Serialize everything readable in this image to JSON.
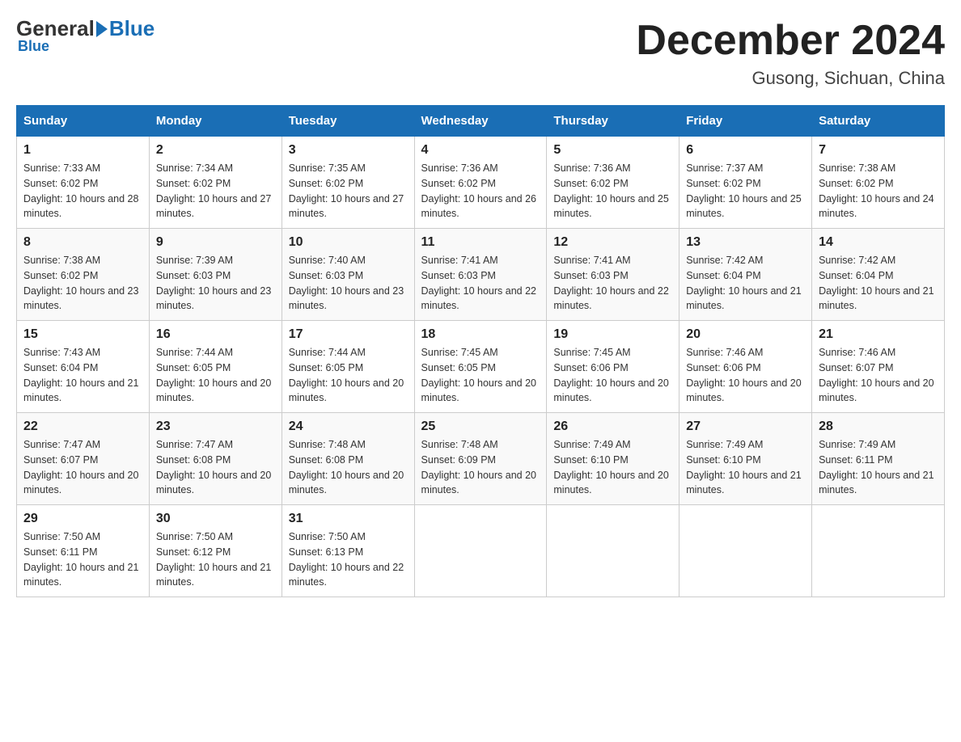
{
  "header": {
    "logo": {
      "general": "General",
      "blue": "Blue"
    },
    "title": "December 2024",
    "location": "Gusong, Sichuan, China"
  },
  "days_of_week": [
    "Sunday",
    "Monday",
    "Tuesday",
    "Wednesday",
    "Thursday",
    "Friday",
    "Saturday"
  ],
  "weeks": [
    [
      {
        "day": 1,
        "sunrise": "7:33 AM",
        "sunset": "6:02 PM",
        "daylight": "10 hours and 28 minutes."
      },
      {
        "day": 2,
        "sunrise": "7:34 AM",
        "sunset": "6:02 PM",
        "daylight": "10 hours and 27 minutes."
      },
      {
        "day": 3,
        "sunrise": "7:35 AM",
        "sunset": "6:02 PM",
        "daylight": "10 hours and 27 minutes."
      },
      {
        "day": 4,
        "sunrise": "7:36 AM",
        "sunset": "6:02 PM",
        "daylight": "10 hours and 26 minutes."
      },
      {
        "day": 5,
        "sunrise": "7:36 AM",
        "sunset": "6:02 PM",
        "daylight": "10 hours and 25 minutes."
      },
      {
        "day": 6,
        "sunrise": "7:37 AM",
        "sunset": "6:02 PM",
        "daylight": "10 hours and 25 minutes."
      },
      {
        "day": 7,
        "sunrise": "7:38 AM",
        "sunset": "6:02 PM",
        "daylight": "10 hours and 24 minutes."
      }
    ],
    [
      {
        "day": 8,
        "sunrise": "7:38 AM",
        "sunset": "6:02 PM",
        "daylight": "10 hours and 23 minutes."
      },
      {
        "day": 9,
        "sunrise": "7:39 AM",
        "sunset": "6:03 PM",
        "daylight": "10 hours and 23 minutes."
      },
      {
        "day": 10,
        "sunrise": "7:40 AM",
        "sunset": "6:03 PM",
        "daylight": "10 hours and 23 minutes."
      },
      {
        "day": 11,
        "sunrise": "7:41 AM",
        "sunset": "6:03 PM",
        "daylight": "10 hours and 22 minutes."
      },
      {
        "day": 12,
        "sunrise": "7:41 AM",
        "sunset": "6:03 PM",
        "daylight": "10 hours and 22 minutes."
      },
      {
        "day": 13,
        "sunrise": "7:42 AM",
        "sunset": "6:04 PM",
        "daylight": "10 hours and 21 minutes."
      },
      {
        "day": 14,
        "sunrise": "7:42 AM",
        "sunset": "6:04 PM",
        "daylight": "10 hours and 21 minutes."
      }
    ],
    [
      {
        "day": 15,
        "sunrise": "7:43 AM",
        "sunset": "6:04 PM",
        "daylight": "10 hours and 21 minutes."
      },
      {
        "day": 16,
        "sunrise": "7:44 AM",
        "sunset": "6:05 PM",
        "daylight": "10 hours and 20 minutes."
      },
      {
        "day": 17,
        "sunrise": "7:44 AM",
        "sunset": "6:05 PM",
        "daylight": "10 hours and 20 minutes."
      },
      {
        "day": 18,
        "sunrise": "7:45 AM",
        "sunset": "6:05 PM",
        "daylight": "10 hours and 20 minutes."
      },
      {
        "day": 19,
        "sunrise": "7:45 AM",
        "sunset": "6:06 PM",
        "daylight": "10 hours and 20 minutes."
      },
      {
        "day": 20,
        "sunrise": "7:46 AM",
        "sunset": "6:06 PM",
        "daylight": "10 hours and 20 minutes."
      },
      {
        "day": 21,
        "sunrise": "7:46 AM",
        "sunset": "6:07 PM",
        "daylight": "10 hours and 20 minutes."
      }
    ],
    [
      {
        "day": 22,
        "sunrise": "7:47 AM",
        "sunset": "6:07 PM",
        "daylight": "10 hours and 20 minutes."
      },
      {
        "day": 23,
        "sunrise": "7:47 AM",
        "sunset": "6:08 PM",
        "daylight": "10 hours and 20 minutes."
      },
      {
        "day": 24,
        "sunrise": "7:48 AM",
        "sunset": "6:08 PM",
        "daylight": "10 hours and 20 minutes."
      },
      {
        "day": 25,
        "sunrise": "7:48 AM",
        "sunset": "6:09 PM",
        "daylight": "10 hours and 20 minutes."
      },
      {
        "day": 26,
        "sunrise": "7:49 AM",
        "sunset": "6:10 PM",
        "daylight": "10 hours and 20 minutes."
      },
      {
        "day": 27,
        "sunrise": "7:49 AM",
        "sunset": "6:10 PM",
        "daylight": "10 hours and 21 minutes."
      },
      {
        "day": 28,
        "sunrise": "7:49 AM",
        "sunset": "6:11 PM",
        "daylight": "10 hours and 21 minutes."
      }
    ],
    [
      {
        "day": 29,
        "sunrise": "7:50 AM",
        "sunset": "6:11 PM",
        "daylight": "10 hours and 21 minutes."
      },
      {
        "day": 30,
        "sunrise": "7:50 AM",
        "sunset": "6:12 PM",
        "daylight": "10 hours and 21 minutes."
      },
      {
        "day": 31,
        "sunrise": "7:50 AM",
        "sunset": "6:13 PM",
        "daylight": "10 hours and 22 minutes."
      },
      null,
      null,
      null,
      null
    ]
  ]
}
